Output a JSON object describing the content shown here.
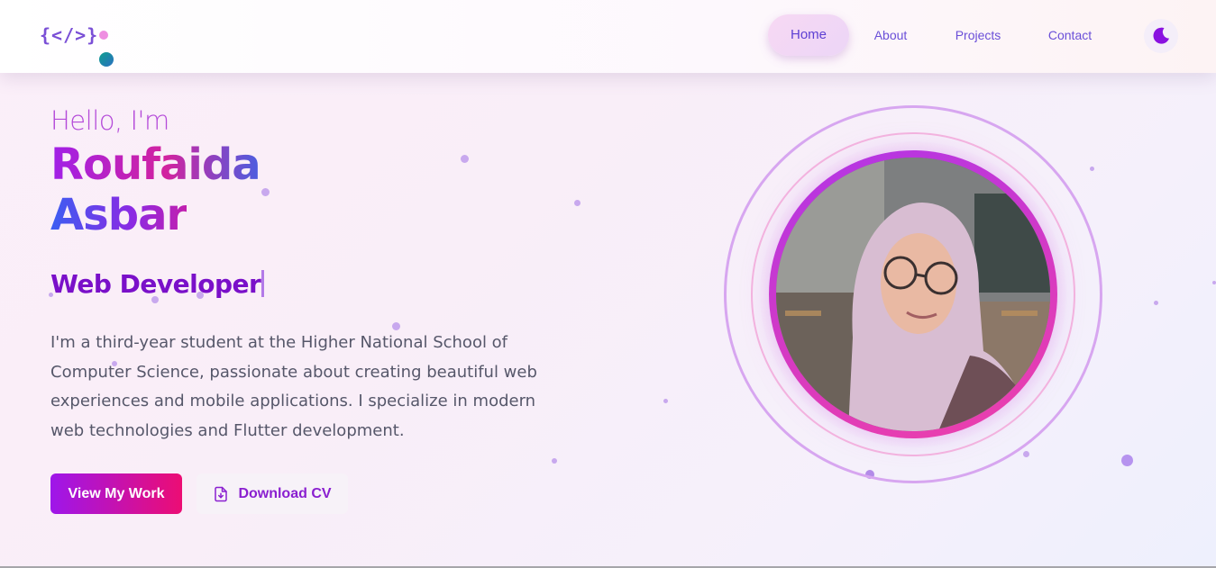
{
  "nav": {
    "logo_text": "{</>}",
    "links": [
      {
        "label": "Home",
        "active": true
      },
      {
        "label": "About",
        "active": false
      },
      {
        "label": "Projects",
        "active": false
      },
      {
        "label": "Contact",
        "active": false
      }
    ],
    "theme_icon": "moon-icon"
  },
  "hero": {
    "greeting": "Hello, I'm",
    "first_name": "Roufaida",
    "last_name": "Asbar",
    "role": "Web Developer",
    "description": "I'm a third-year student at the Higher National School of Computer Science, passionate about creating beautiful web experiences and mobile applications. I specialize in modern web technologies and Flutter development.",
    "primary_button": "View My Work",
    "secondary_button": "Download CV",
    "secondary_icon": "file-download-icon"
  },
  "colors": {
    "accent_purple": "#a020e8",
    "accent_pink": "#ec0d74",
    "nav_text": "#6a4fd8",
    "body_text": "#56576a"
  }
}
